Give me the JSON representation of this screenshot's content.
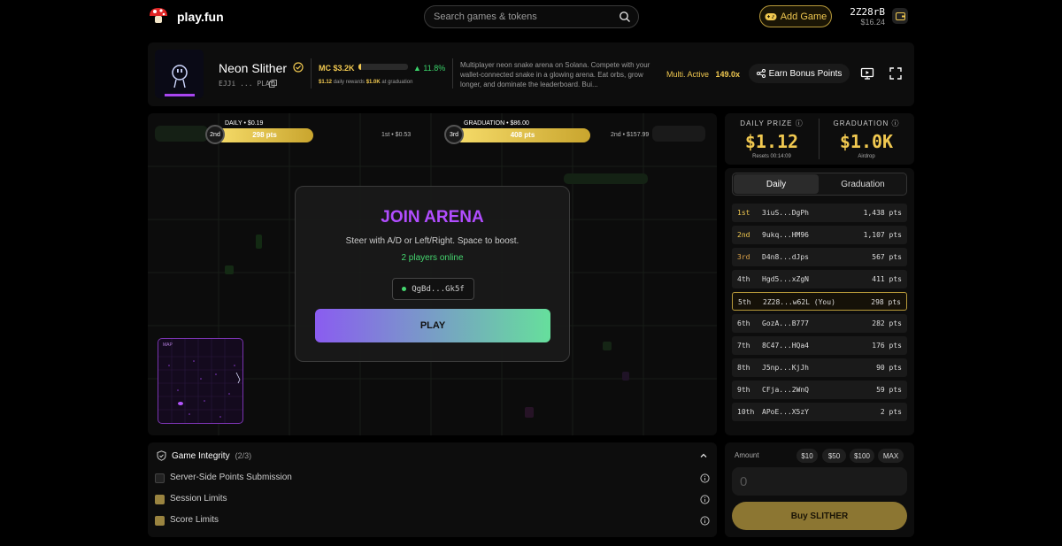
{
  "brand": {
    "name": "play.fun",
    "logo_icon": "mushroom-icon"
  },
  "search": {
    "placeholder": "Search games & tokens"
  },
  "header_actions": {
    "add_game_label": "Add Game",
    "user_id": "2Z28rB",
    "user_balance": "$16.24"
  },
  "game": {
    "name": "Neon Slither",
    "ticker": "EJJi ... PLAY",
    "market_cap_label": "MC $3.2K",
    "market_cap_progress_pct": 5,
    "change_pct": "▲ 11.8%",
    "daily_rewards_value": "$1.12",
    "daily_rewards_label": "daily rewards",
    "graduation_value": "$1.0K",
    "graduation_label": "at graduation",
    "description": "Multiplayer neon snake arena on Solana. Compete with your wallet-connected snake in a glowing arena. Eat orbs, grow longer, and dominate the leaderboard. Bui...",
    "multi_label": "Multi. Active",
    "multi_value": "149.0x",
    "bonus_label": "Earn Bonus Points"
  },
  "progress": {
    "daily": {
      "label": "DAILY • $0.19",
      "rank": "2nd",
      "points": "298 pts",
      "next": "1st • $0.53"
    },
    "graduation": {
      "label": "GRADUATION • $86.00",
      "rank": "3rd",
      "points": "408 pts",
      "next": "2nd • $157.99"
    }
  },
  "join": {
    "title": "JOIN ARENA",
    "subtitle": "Steer with A/D or Left/Right. Space to boost.",
    "online": "2 players online",
    "address": "QgBd...Gk5f",
    "play_label": "PLAY"
  },
  "minimap": {
    "label": "MAP"
  },
  "prize": {
    "daily_label": "DAILY PRIZE",
    "daily_value": "$1.12",
    "daily_sub": "Resets 00:14:09",
    "grad_label": "GRADUATION",
    "grad_value": "$1.0K",
    "grad_sub": "Airdrop"
  },
  "leaderboard": {
    "tabs": [
      "Daily",
      "Graduation"
    ],
    "rows": [
      {
        "rank": "1st",
        "name": "3iuS...DgPh",
        "pts": "1,438 pts"
      },
      {
        "rank": "2nd",
        "name": "9ukq...HM96",
        "pts": "1,107 pts"
      },
      {
        "rank": "3rd",
        "name": "D4n8...dJps",
        "pts": "567 pts"
      },
      {
        "rank": "4th",
        "name": "Hgd5...xZgN",
        "pts": "411 pts"
      },
      {
        "rank": "5th",
        "name": "2Z28...w62L (You)",
        "pts": "298 pts"
      },
      {
        "rank": "6th",
        "name": "GozA...B777",
        "pts": "282 pts"
      },
      {
        "rank": "7th",
        "name": "8C47...HQa4",
        "pts": "176 pts"
      },
      {
        "rank": "8th",
        "name": "J5np...KjJh",
        "pts": "90 pts"
      },
      {
        "rank": "9th",
        "name": "CFja...2WnQ",
        "pts": "59 pts"
      },
      {
        "rank": "10th",
        "name": "APoE...X5zY",
        "pts": "2 pts"
      }
    ]
  },
  "integrity": {
    "title": "Game Integrity",
    "count": "(2/3)",
    "items": [
      {
        "label": "Server-Side Points Submission",
        "checked": false
      },
      {
        "label": "Session Limits",
        "checked": true
      },
      {
        "label": "Score Limits",
        "checked": true
      }
    ]
  },
  "buy": {
    "amount_label": "Amount",
    "chips": [
      "$10",
      "$50",
      "$100",
      "MAX"
    ],
    "placeholder": "0",
    "button_label": "Buy SLITHER"
  },
  "colors": {
    "accent_gold": "#f0c850",
    "join_purple": "#b14dff",
    "online_green": "#45d66f"
  }
}
